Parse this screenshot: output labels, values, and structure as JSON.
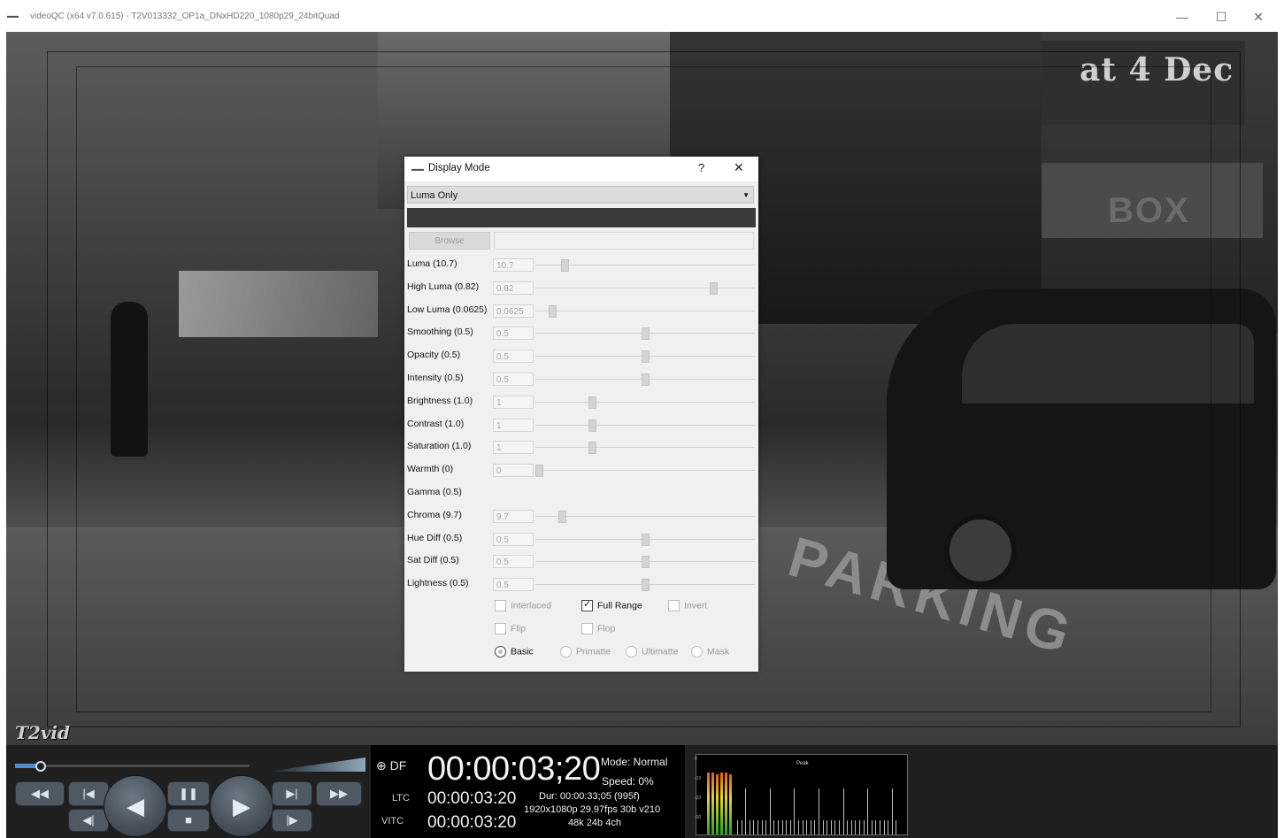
{
  "window": {
    "app_icon": "▬▬",
    "title": "videoQC (x64 v7.0.615) - T2V013332_OP1a_DNxHD220_1080p29_24bitQuad",
    "minimize_icon": "—",
    "maximize_icon": "☐",
    "close_icon": "✕"
  },
  "video": {
    "sign_text": "at 4 Dec",
    "box_sign_text": "BOX",
    "road_marking": "PARKING",
    "logo": "T2vid"
  },
  "dialog": {
    "title": "Display Mode",
    "help": "?",
    "close": "✕",
    "mode_selected": "Luma Only",
    "dropdown_arrow": "▼",
    "browse_label": "Browse",
    "params": [
      {
        "label": "Luma (10.7)",
        "value": "10.7",
        "level": 0.12
      },
      {
        "label": "High Luma (0.82)",
        "value": "0.82",
        "level": 0.82
      },
      {
        "label": "Low Luma (0.0625)",
        "value": "0.0625",
        "level": 0.0625
      },
      {
        "label": "Smoothing (0.5)",
        "value": "0.5",
        "level": 0.5
      },
      {
        "label": "Opacity (0.5)",
        "value": "0.5",
        "level": 0.5
      },
      {
        "label": "Intensity (0.5)",
        "value": "0.5",
        "level": 0.5
      },
      {
        "label": "Brightness (1.0)",
        "value": "1",
        "level": 0.25
      },
      {
        "label": "Contrast (1.0)",
        "value": "1",
        "level": 0.25
      },
      {
        "label": "Saturation (1.0)",
        "value": "1",
        "level": 0.25
      },
      {
        "label": "Warmth (0)",
        "value": "0",
        "level": 0.0
      },
      {
        "label": "Gamma (0.5)"
      },
      {
        "label": "Chroma (9.7)",
        "value": "9.7",
        "level": 0.11
      },
      {
        "label": "Hue Diff (0.5)",
        "value": "0.5",
        "level": 0.5
      },
      {
        "label": "Sat Diff (0.5)",
        "value": "0.5",
        "level": 0.5
      },
      {
        "label": "Lightness (0.5)",
        "value": "0.5",
        "level": 0.5
      }
    ],
    "options": {
      "interlaced": "Interlaced",
      "full_range": "Full Range",
      "invert": "Invert",
      "flip": "Flip",
      "flop": "Flop",
      "basic": "Basic",
      "primatte": "Primatte",
      "ultimatte": "Ultimatte",
      "mask": "Mask"
    }
  },
  "controls": {
    "scrub_position": 0.1,
    "rewind_icon": "◀◀",
    "prev_icon": "|◀",
    "step_back_icon": "◀|",
    "reverse_icon": "◀",
    "pause_icon": "❚❚",
    "stop_icon": "■",
    "play_icon": "▶",
    "next_icon": "▶|",
    "step_fwd_icon": "|▶",
    "ffwd_icon": "▶▶"
  },
  "timecode": {
    "df_icon": "⊕",
    "df": "DF",
    "main": "00:00:03;20",
    "mode": "Mode: Normal",
    "speed": "Speed: 0%",
    "ltc_label": "LTC",
    "ltc": "00:00:03:20",
    "vitc_label": "VITC",
    "vitc": "00:00:03:20",
    "dur": "Dur: 00:00:33;05 (995f)",
    "format": "1920x1080p 29.97fps 30b v210",
    "audio": "48k 24b 4ch"
  },
  "meter": {
    "title": "Peak",
    "ticks": [
      "0",
      "-10",
      "-20",
      "-30"
    ]
  }
}
